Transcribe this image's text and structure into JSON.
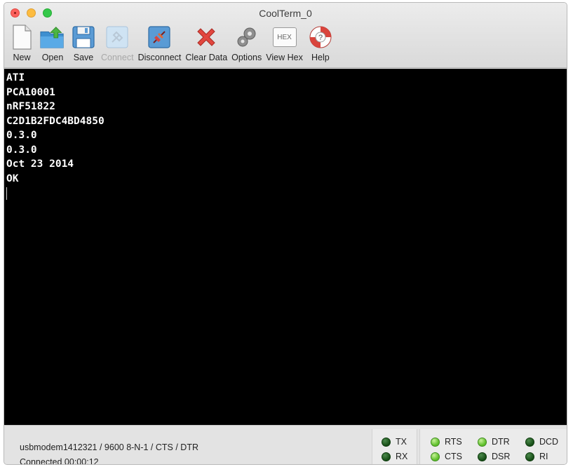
{
  "window": {
    "title": "CoolTerm_0"
  },
  "toolbar": {
    "new_label": "New",
    "open_label": "Open",
    "save_label": "Save",
    "connect_label": "Connect",
    "disconnect_label": "Disconnect",
    "clear_label": "Clear Data",
    "options_label": "Options",
    "viewhex_label": "View Hex",
    "viewhex_icon_text": "HEX",
    "help_label": "Help"
  },
  "terminal": {
    "lines": [
      "ATI",
      "PCA10001",
      "nRF51822",
      "C2D1B2FDC4BD4850",
      "0.3.0",
      "0.3.0",
      "Oct 23 2014",
      "OK"
    ]
  },
  "status": {
    "port_info": "usbmodem1412321 / 9600 8-N-1 / CTS / DTR",
    "connection": "Connected 00:00:12"
  },
  "indicators": {
    "tx": {
      "label": "TX",
      "state": "off"
    },
    "rx": {
      "label": "RX",
      "state": "off"
    },
    "rts": {
      "label": "RTS",
      "state": "on"
    },
    "cts": {
      "label": "CTS",
      "state": "on"
    },
    "dtr": {
      "label": "DTR",
      "state": "on"
    },
    "dsr": {
      "label": "DSR",
      "state": "off"
    },
    "dcd": {
      "label": "DCD",
      "state": "off"
    },
    "ri": {
      "label": "RI",
      "state": "off"
    }
  },
  "colors": {
    "terminal_bg": "#000000",
    "terminal_fg": "#ffffff",
    "led_on": "#5fbf2b",
    "led_off": "#164d16"
  }
}
